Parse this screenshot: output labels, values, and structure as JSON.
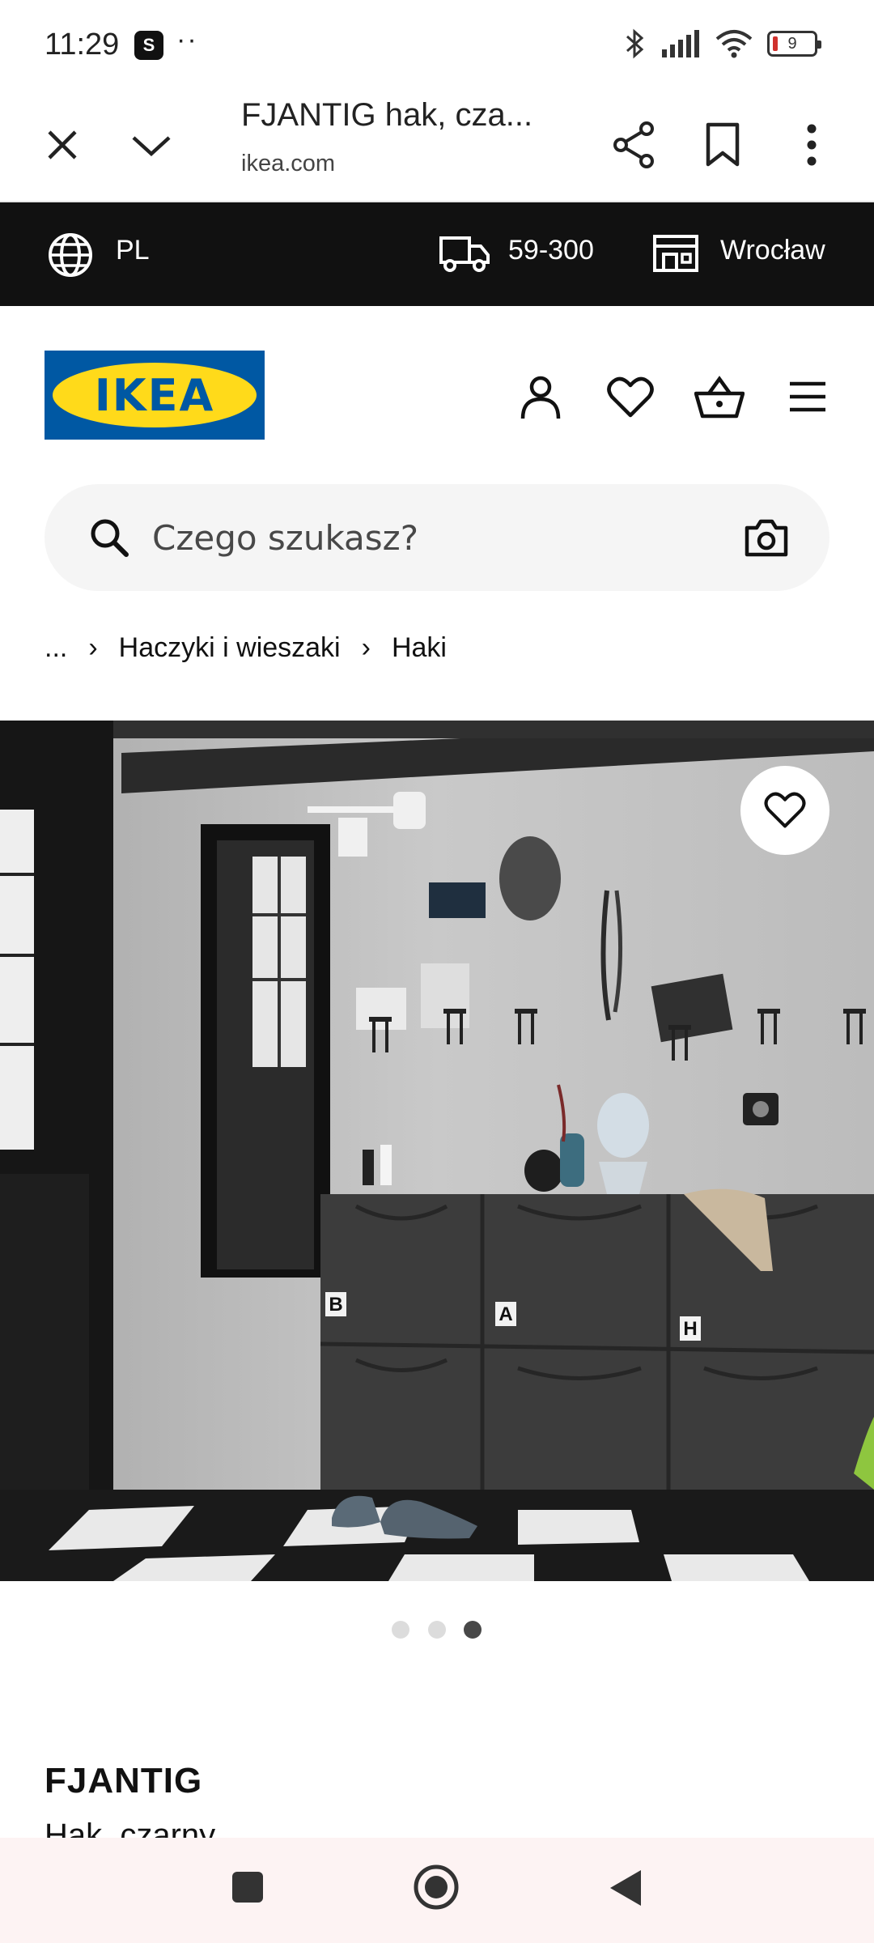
{
  "status_bar": {
    "time": "11:29",
    "app_icon": "S",
    "dots": "··",
    "battery": "9"
  },
  "browser": {
    "title": "FJANTIG hak, cza...",
    "url": "ikea.com"
  },
  "topbar": {
    "language": "PL",
    "postcode": "59-300",
    "store": "Wrocław"
  },
  "header": {
    "logo_text": "IKEA"
  },
  "search": {
    "placeholder": "Czego szukasz?"
  },
  "breadcrumb": {
    "ellipsis": "...",
    "items": [
      "Haczyki i wieszaki",
      "Haki"
    ]
  },
  "hero": {
    "drawer_labels": [
      "B",
      "A",
      "H"
    ]
  },
  "carousel": {
    "count": 3,
    "active_index": 2
  },
  "product": {
    "name": "FJANTIG",
    "description": "Hak, czarny"
  },
  "colors": {
    "ikea_blue": "#0058a3",
    "ikea_yellow": "#ffda1a",
    "topbar_bg": "#111111"
  }
}
